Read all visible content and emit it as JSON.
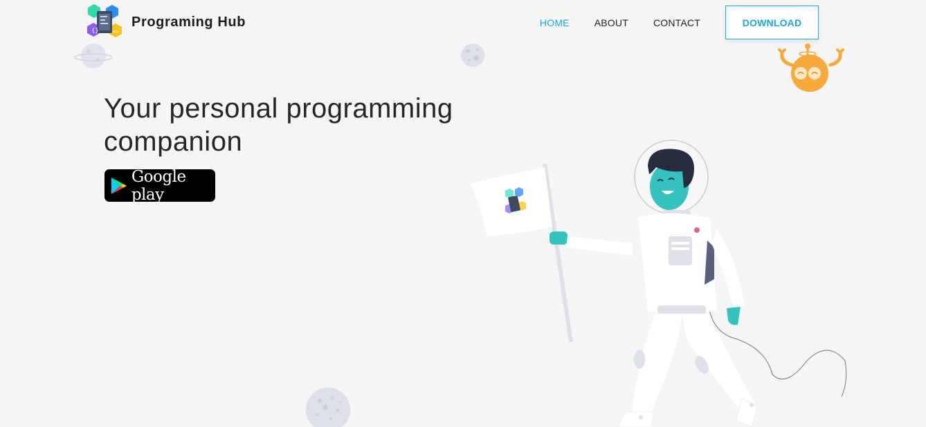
{
  "header": {
    "brand_name": "Programing Hub",
    "nav": {
      "home": "HOME",
      "about": "ABOUT",
      "contact": "CONTACT"
    },
    "download_label": "DOWNLOAD"
  },
  "hero": {
    "title": "Your personal programming companion",
    "store_badge_label": "Google play"
  },
  "colors": {
    "accent": "#1aa7dc",
    "background": "#f5f5f5",
    "astronaut_skin": "#35c3c0",
    "robot_orange": "#f7a93b"
  },
  "icons": [
    "app-logo-icon",
    "google-play-icon",
    "planet-icon",
    "asteroid-icon",
    "robot-icon",
    "astronaut-illustration",
    "flag-icon"
  ]
}
